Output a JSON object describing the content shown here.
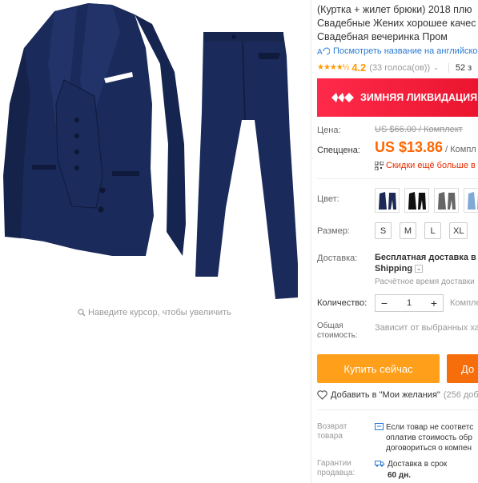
{
  "product": {
    "title_lines": [
      "(Куртка + жилет брюки) 2018 плю",
      "Свадебные Жених хорошее качес",
      "Свадебная вечеринка Пром"
    ],
    "translate_link": "Посмотреть название на английско",
    "rating_stars": "★★★★½",
    "rating_value": "4.2",
    "rating_count": "(33 голоса(ов))",
    "orders": "52 з",
    "zoom_hint": "Наведите курсор, чтобы увеличить",
    "colors": {
      "accent": "#f60",
      "banner": "#e8132c",
      "buy": "#ff9f1a",
      "cart": "#f66d0b",
      "suit": "#1c2a55"
    }
  },
  "banner": {
    "text": "ЗИМНЯЯ ЛИКВИДАЦИЯ"
  },
  "price": {
    "label": "Цена:",
    "old_price": "US $66.00 / Комплект",
    "special_label": "Спеццена:",
    "new_price": "US $13.86",
    "unit": " / Компл",
    "discount_text": "Скидки ещё больше в п"
  },
  "options": {
    "color_label": "Цвет:",
    "colors": [
      "navy-suit-swatch",
      "black-suit-swatch",
      "gray-suit-swatch",
      "light-blue-suit-swatch"
    ],
    "size_label": "Размер:",
    "sizes": [
      "S",
      "M",
      "L",
      "XL"
    ]
  },
  "shipping": {
    "label": "Доставка:",
    "main": "Бесплатная доставка в R",
    "method": "Shipping",
    "estimate": "Расчётное время доставки"
  },
  "quantity": {
    "label": "Количество:",
    "value": "1",
    "note": "Компле",
    "minus": "−",
    "plus": "+"
  },
  "total": {
    "label_line1": "Общая",
    "label_line2": "стоимость:",
    "value": "Зависит от выбранных хар"
  },
  "actions": {
    "buy": "Купить сейчас",
    "cart": "До"
  },
  "wishlist": {
    "label": "Добавить в \"Мои желания\"",
    "count": "(256 доба"
  },
  "returns": {
    "label_line1": "Возврат",
    "label_line2": "товара",
    "lines": [
      "Если товар не соответс",
      "оплатив стоимость обр",
      "договориться о компен"
    ]
  },
  "guarantee": {
    "label_line1": "Гарантии",
    "label_line2": "продавца:",
    "line1": "Доставка в срок",
    "days": "60 дн."
  }
}
